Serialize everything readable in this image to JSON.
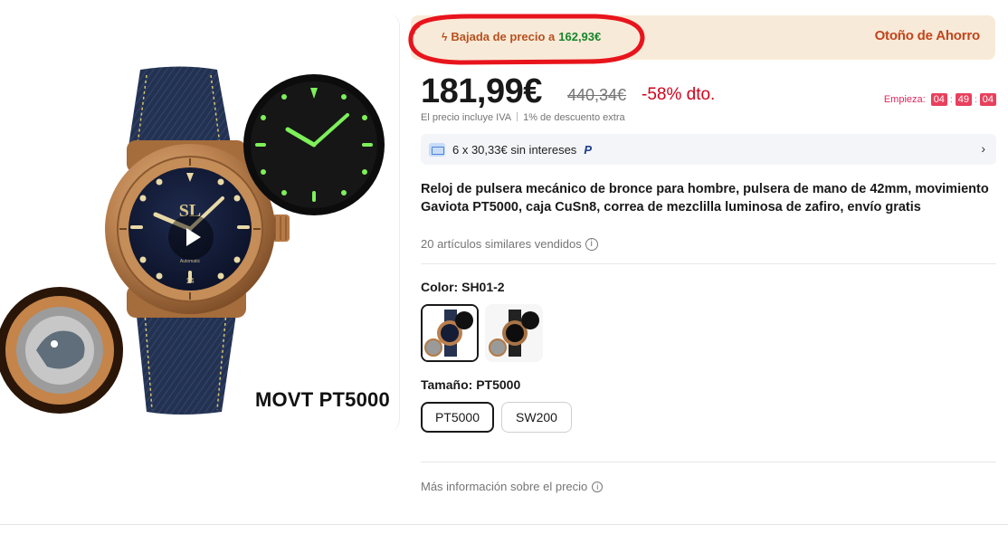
{
  "gallery": {
    "caption": "MOVT PT5000",
    "dial_brand": "SL",
    "dial_text": "Automatic",
    "dial_number": "14"
  },
  "promo": {
    "price_drop_prefix": "Bajada de precio a",
    "price_drop_value": "162,93€",
    "campaign": "Otoño de Ahorro",
    "colors": {
      "banner_bg": "#f8ead8",
      "accent": "#c2451d",
      "green": "#16852a",
      "scribble": "#e8141c"
    }
  },
  "price": {
    "current": "181,99€",
    "original": "440,34€",
    "discount": "-58% dto.",
    "countdown_label": "Empieza:",
    "countdown": [
      "04",
      "49",
      "04"
    ]
  },
  "tax": {
    "vat_text": "El precio incluye IVA",
    "extra_discount": "1% de descuento extra"
  },
  "installments": {
    "text": "6 x 30,33€ sin intereses",
    "provider": "P"
  },
  "product": {
    "title": "Reloj de pulsera mecánico de bronce para hombre, pulsera de mano de 42mm, movimiento Gaviota PT5000, caja CuSn8, correa de mezclilla luminosa de zafiro, envío gratis",
    "sold": "20 artículos similares vendidos"
  },
  "color": {
    "label": "Color:",
    "selected": "SH01-2"
  },
  "size": {
    "label": "Tamaño:",
    "selected": "PT5000",
    "options": [
      "PT5000",
      "SW200"
    ]
  },
  "more_info": "Más información sobre el precio"
}
